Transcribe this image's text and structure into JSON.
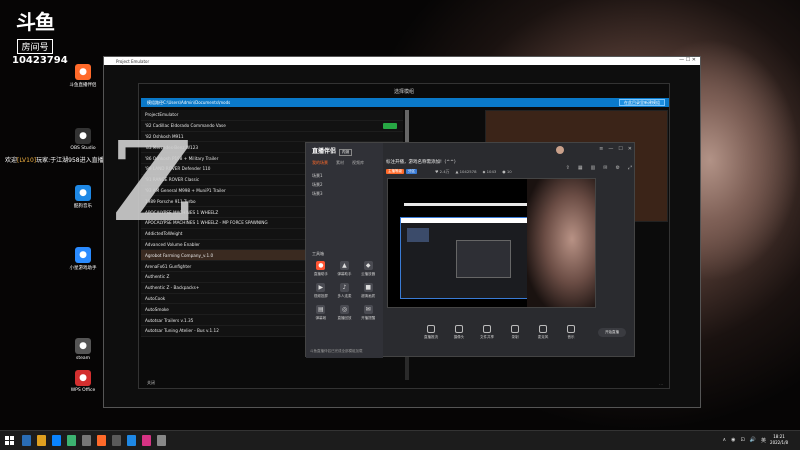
{
  "douyu": {
    "logo": "斗鱼",
    "room_label": "房间号",
    "room_id": "10423794"
  },
  "welcome": {
    "prefix": "欢迎",
    "level": "[LV10]",
    "text": "玩家:于江湖958进入直播间"
  },
  "desktop_icons": [
    {
      "label": "斗鱼直播伴侣",
      "color": "#ff6a2a"
    },
    {
      "label": "OBS Studio",
      "color": "#333"
    },
    {
      "label": "酷狗音乐",
      "color": "#1e88e5"
    },
    {
      "label": "小星游戏助手",
      "color": "#2a8bff"
    },
    {
      "label": "steam",
      "color": "#555"
    },
    {
      "label": "WPS Office",
      "color": "#d32f2f"
    }
  ],
  "main_window": {
    "title": "Project Emulator",
    "inner_title": "选择模组",
    "path_text": "模组路径C:\\Users\\Admin\\Documents\\mods",
    "path_button": "在此目录里新建模组",
    "mods": [
      "ProjectEmulator",
      "'82 Cadillac Eldorado Commando Vase",
      "'82 Oshkosh M911",
      "'83 Mercedes-Benz W123",
      "'86 Oshkosh P198 + Military Trailer",
      "'89 LAND ROVER Defender 110",
      "'91 RANGE ROVER Classic",
      "'93 AM General M998 + MuniP1 Trailer",
      "1989 Porsche 911 Turbo",
      "APOCALYPSE MACHINES 1 WHEELZ",
      "APOCALYPSE MACHINES 1 WHEELZ - MP FORCE SPAWNING",
      "AddictedToWeight",
      "Advanced Volume Enabler",
      "Agrobot Farming Company_v.1.0",
      "ArenaFx61 Gunfighter",
      "Authentic Z",
      "Authentic Z - Backpacks+",
      "AutoCook",
      "AutoSmoke",
      "Autotsar Trailers v.1.35",
      "Autotsar Tuning Atelier - Bus v.1.12"
    ],
    "enabled_rows": [
      1,
      4,
      6,
      20
    ],
    "selected_index": 13,
    "foot_left": "关闭",
    "foot_right": "..."
  },
  "assistant": {
    "logo": "直播伴侣",
    "badge": "内测",
    "tabs": [
      "我的场景",
      "素材",
      "视频库"
    ],
    "scenes": [
      "场景1",
      "场景2",
      "场景3"
    ],
    "tools_header": "工具箱",
    "tools": [
      {
        "label": "直播助手",
        "glyph": "●",
        "hot": true
      },
      {
        "label": "弹幕助手",
        "glyph": "▲"
      },
      {
        "label": "云播放器",
        "glyph": "◆"
      },
      {
        "label": "视频投屏",
        "glyph": "▶"
      },
      {
        "label": "多人连麦",
        "glyph": "♪"
      },
      {
        "label": "超清画质",
        "glyph": "■"
      },
      {
        "label": "弹幕姬",
        "glyph": "▤"
      },
      {
        "label": "直播回放",
        "glyph": "◎"
      },
      {
        "label": "开播提醒",
        "glyph": "✉"
      }
    ],
    "note": "斗鱼直播伴侣已完成全部模组加载",
    "head_text": "标注开播，游戏名称需添加!（^^）",
    "badges": [
      {
        "text": "主播等级",
        "color": "#ff6a2a"
      },
      {
        "text": "分区",
        "color": "#3a7bd5"
      }
    ],
    "stats": [
      "♥ 2.4万",
      "▲ 1042578",
      "◆ 1043",
      "● 10"
    ],
    "toolbar": [
      "直播推流",
      "摄像头",
      "文件共享",
      "录制",
      "麦克风",
      "音乐"
    ],
    "start_button": "开始直播"
  },
  "taskbar": {
    "icons": [
      "#2a6db5",
      "#e0a020",
      "#0a84ff",
      "#3cb371",
      "#777",
      "#ff6a2a",
      "#5a5a5a",
      "#1e88e5",
      "#d63384",
      "#888"
    ],
    "tray": [
      "∧",
      "◉",
      "⊡",
      "🔊",
      "英"
    ],
    "time": "18:21",
    "date": "2022/1/8"
  }
}
